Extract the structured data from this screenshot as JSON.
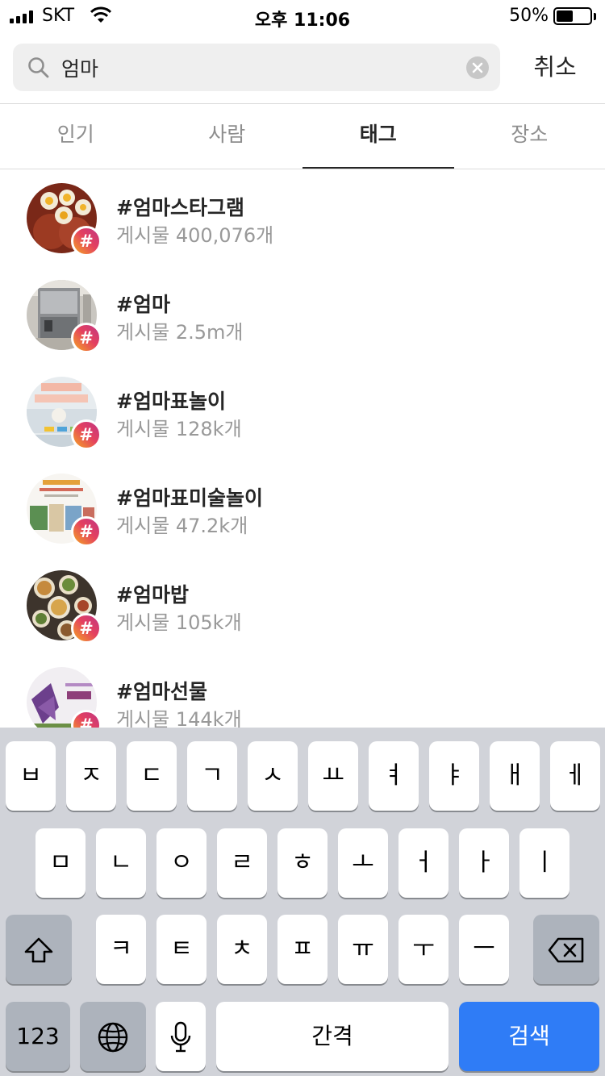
{
  "status_bar": {
    "carrier": "SKT",
    "time": "오후 11:06",
    "battery_percent": "50%",
    "battery_level": 0.5
  },
  "search": {
    "query": "엄마",
    "cancel_label": "취소"
  },
  "tabs": [
    {
      "label": "인기",
      "active": false
    },
    {
      "label": "사람",
      "active": false
    },
    {
      "label": "태그",
      "active": true
    },
    {
      "label": "장소",
      "active": false
    }
  ],
  "results": [
    {
      "tag": "#엄마스타그램",
      "count": "게시물 400,076개",
      "badge": "#"
    },
    {
      "tag": "#엄마",
      "count": "게시물 2.5m개",
      "badge": "#"
    },
    {
      "tag": "#엄마표놀이",
      "count": "게시물 128k개",
      "badge": "#"
    },
    {
      "tag": "#엄마표미술놀이",
      "count": "게시물 47.2k개",
      "badge": "#"
    },
    {
      "tag": "#엄마밥",
      "count": "게시물 105k개",
      "badge": "#"
    },
    {
      "tag": "#엄마선물",
      "count": "게시물 144k개",
      "badge": "#"
    }
  ],
  "keyboard": {
    "row1": [
      "ㅂ",
      "ㅈ",
      "ㄷ",
      "ㄱ",
      "ㅅ",
      "ㅛ",
      "ㅕ",
      "ㅑ",
      "ㅐ",
      "ㅔ"
    ],
    "row2": [
      "ㅁ",
      "ㄴ",
      "ㅇ",
      "ㄹ",
      "ㅎ",
      "ㅗ",
      "ㅓ",
      "ㅏ",
      "ㅣ"
    ],
    "row3": [
      "ㅋ",
      "ㅌ",
      "ㅊ",
      "ㅍ",
      "ㅠ",
      "ㅜ",
      "ㅡ"
    ],
    "numbers_label": "123",
    "space_label": "간격",
    "search_label": "검색",
    "icons": {
      "shift": "shift-icon",
      "backspace": "backspace-icon",
      "globe": "globe-icon",
      "mic": "microphone-icon"
    }
  },
  "colors": {
    "accent_blue": "#2f7cf6",
    "badge_gradient": [
      "#f5a623",
      "#e4405f",
      "#c13584"
    ]
  }
}
